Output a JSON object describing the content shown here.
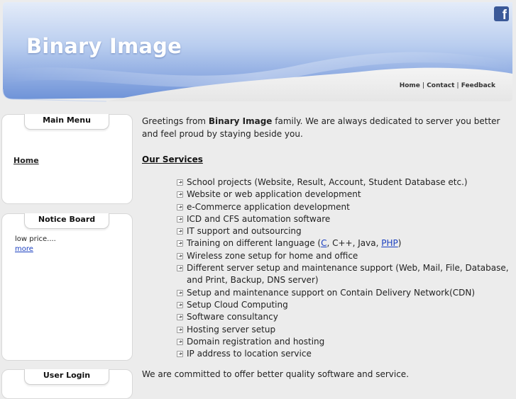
{
  "header": {
    "site_title": "Binary Image",
    "nav": [
      "Home",
      "Contact",
      "Feedback"
    ],
    "social_icon": "facebook-icon",
    "social_glyph": "f"
  },
  "sidebar": {
    "main_menu": {
      "title": "Main Menu",
      "items": [
        "Home"
      ]
    },
    "notice_board": {
      "title": "Notice Board",
      "text": "low price....",
      "more_link": "more"
    },
    "user_login": {
      "title": "User Login"
    }
  },
  "main": {
    "intro_prefix": "Greetings from ",
    "intro_brand": "Binary Image",
    "intro_suffix": " family. We are always dedicated to server you better and feel proud by staying beside you.",
    "services_heading": "Our Services",
    "services": [
      "School projects (Website, Result, Account, Student Database etc.)",
      "Website or web application development",
      "e-Commerce application development",
      "ICD and CFS automation software",
      "IT support and outsourcing",
      {
        "prefix": "Training on different language (",
        "link1": "C",
        "middle": ", C++, Java, ",
        "link2": "PHP",
        "suffix": ")"
      },
      "Wireless zone setup for home and office",
      "Different server setup and maintenance support (Web, Mail, File, Database, and Print, Backup, DNS server)",
      "Setup and maintenance support on Contain Delivery Network(CDN)",
      "Setup Cloud Computing",
      "Software consultancy",
      "Hosting server setup",
      "Domain registration and hosting",
      "IP address to location service"
    ],
    "closing": "We are committed to offer better quality software and service."
  },
  "colors": {
    "banner_light": "#dfe9f8",
    "banner_mid": "#9db8e6",
    "banner_dark": "#5f86d2",
    "link": "#1a3fc0",
    "background": "#ececec"
  }
}
